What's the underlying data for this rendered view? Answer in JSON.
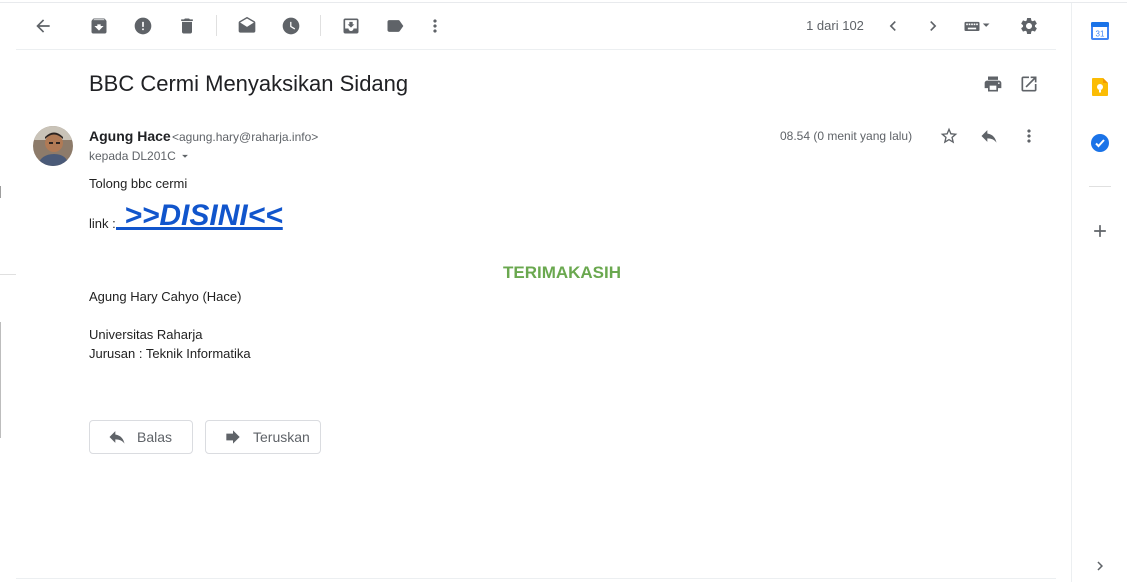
{
  "toolbar": {
    "back_icon": "arrow-back-icon",
    "archive_icon": "archive-icon",
    "report_spam_icon": "report-spam-icon",
    "delete_icon": "trash-icon",
    "mark_unread_icon": "mark-unread-icon",
    "snooze_icon": "clock-icon",
    "move_to_icon": "move-to-inbox-icon",
    "labels_icon": "label-icon",
    "more_icon": "more-vertical-icon",
    "pagination": "1 dari 102",
    "prev_icon": "chevron-left-icon",
    "next_icon": "chevron-right-icon",
    "input_tools_icon": "keyboard-icon",
    "settings_icon": "gear-icon"
  },
  "email": {
    "subject": "BBC Cermi Menyaksikan Sidang",
    "sender_name": "Agung Hace",
    "sender_email": "<agung.hary@raharja.info>",
    "recipient": "kepada DL201C",
    "timestamp": "08.54 (0 menit yang lalu)",
    "body": {
      "line1": "Tolong bbc cermi",
      "link_prefix": "link : ",
      "link_text": " >>DISINI<<",
      "thanks": "TERIMAKASIH",
      "sig_name": "Agung Hary Cahyo (Hace)",
      "sig_org": "Universitas Raharja",
      "sig_dept": "Jurusan : Teknik Informatika"
    }
  },
  "actions": {
    "reply_label": "Balas",
    "forward_label": "Teruskan"
  },
  "side_panel": {
    "calendar_day": "31",
    "apps": [
      "calendar-icon",
      "keep-icon",
      "tasks-icon",
      "add-icon"
    ],
    "expand_icon": "chevron-right-icon"
  },
  "colors": {
    "link": "#1155cc",
    "thanks": "#6aa84f",
    "calendar": "#4285f4",
    "keep": "#fbbc04",
    "tasks": "#1a73e8"
  }
}
